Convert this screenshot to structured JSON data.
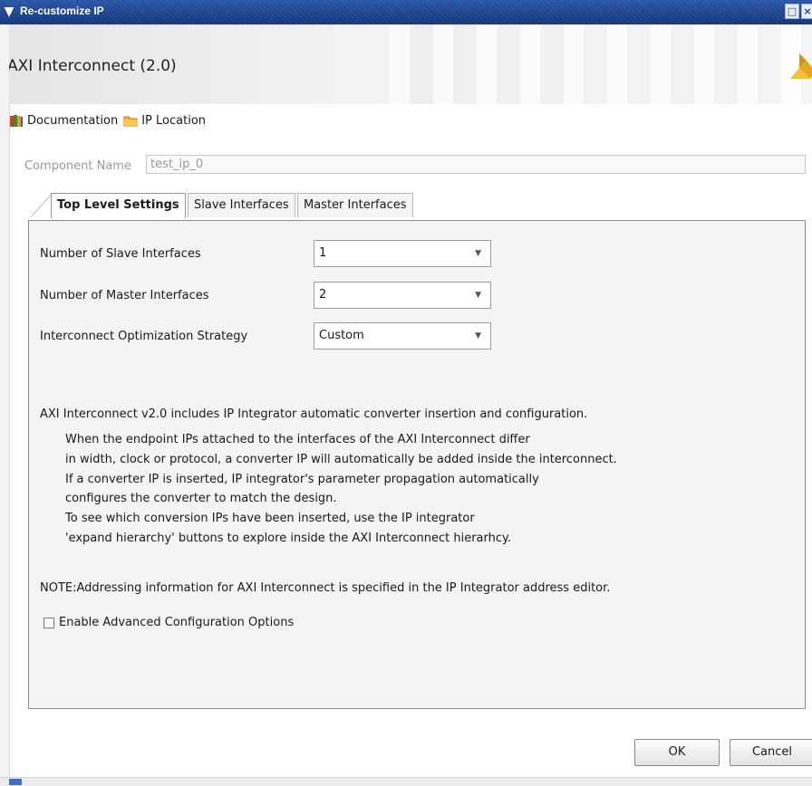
{
  "window": {
    "title": "Re-customize IP",
    "menu_icon": "chevron-down-icon",
    "controls": [
      "restore-icon",
      "close-icon"
    ]
  },
  "header": {
    "ip_title": "AXI Interconnect (2.0)",
    "logo": "vivado-logo"
  },
  "links": [
    {
      "label": "Documentation",
      "icon": "books-icon"
    },
    {
      "label": "IP Location",
      "icon": "folder-icon"
    }
  ],
  "component": {
    "label": "Component Name",
    "value": "test_ip_0"
  },
  "tabs": [
    {
      "label": "Top Level Settings",
      "active": true
    },
    {
      "label": "Slave Interfaces",
      "active": false
    },
    {
      "label": "Master Interfaces",
      "active": false
    }
  ],
  "settings": {
    "slave_label": "Number of Slave Interfaces",
    "slave_value": "1",
    "master_label": "Number of Master Interfaces",
    "master_value": "2",
    "strategy_label": "Interconnect Optimization Strategy",
    "strategy_value": "Custom"
  },
  "info": {
    "intro": "AXI Interconnect v2.0 includes IP Integrator automatic converter insertion and configuration.",
    "lines": [
      "When the endpoint IPs attached to the interfaces of the AXI Interconnect differ",
      "in width, clock or protocol, a converter IP will automatically be added inside the interconnect.",
      "If a converter IP is inserted, IP integrator's parameter propagation automatically",
      "configures the converter to match the design.",
      "To see which conversion IPs have been inserted, use the IP integrator",
      "'expand hierarchy' buttons to explore inside the AXI Interconnect hierarhcy."
    ],
    "note": "NOTE:Addressing information for AXI Interconnect is specified in the IP Integrator address editor."
  },
  "advanced": {
    "label": "Enable Advanced Configuration Options",
    "checked": false
  },
  "buttons": {
    "ok": "OK",
    "cancel": "Cancel"
  },
  "colors": {
    "titlebar": "#1f4a9a",
    "panel_bg": "#f4f4f4",
    "logo": "#e8b520"
  }
}
